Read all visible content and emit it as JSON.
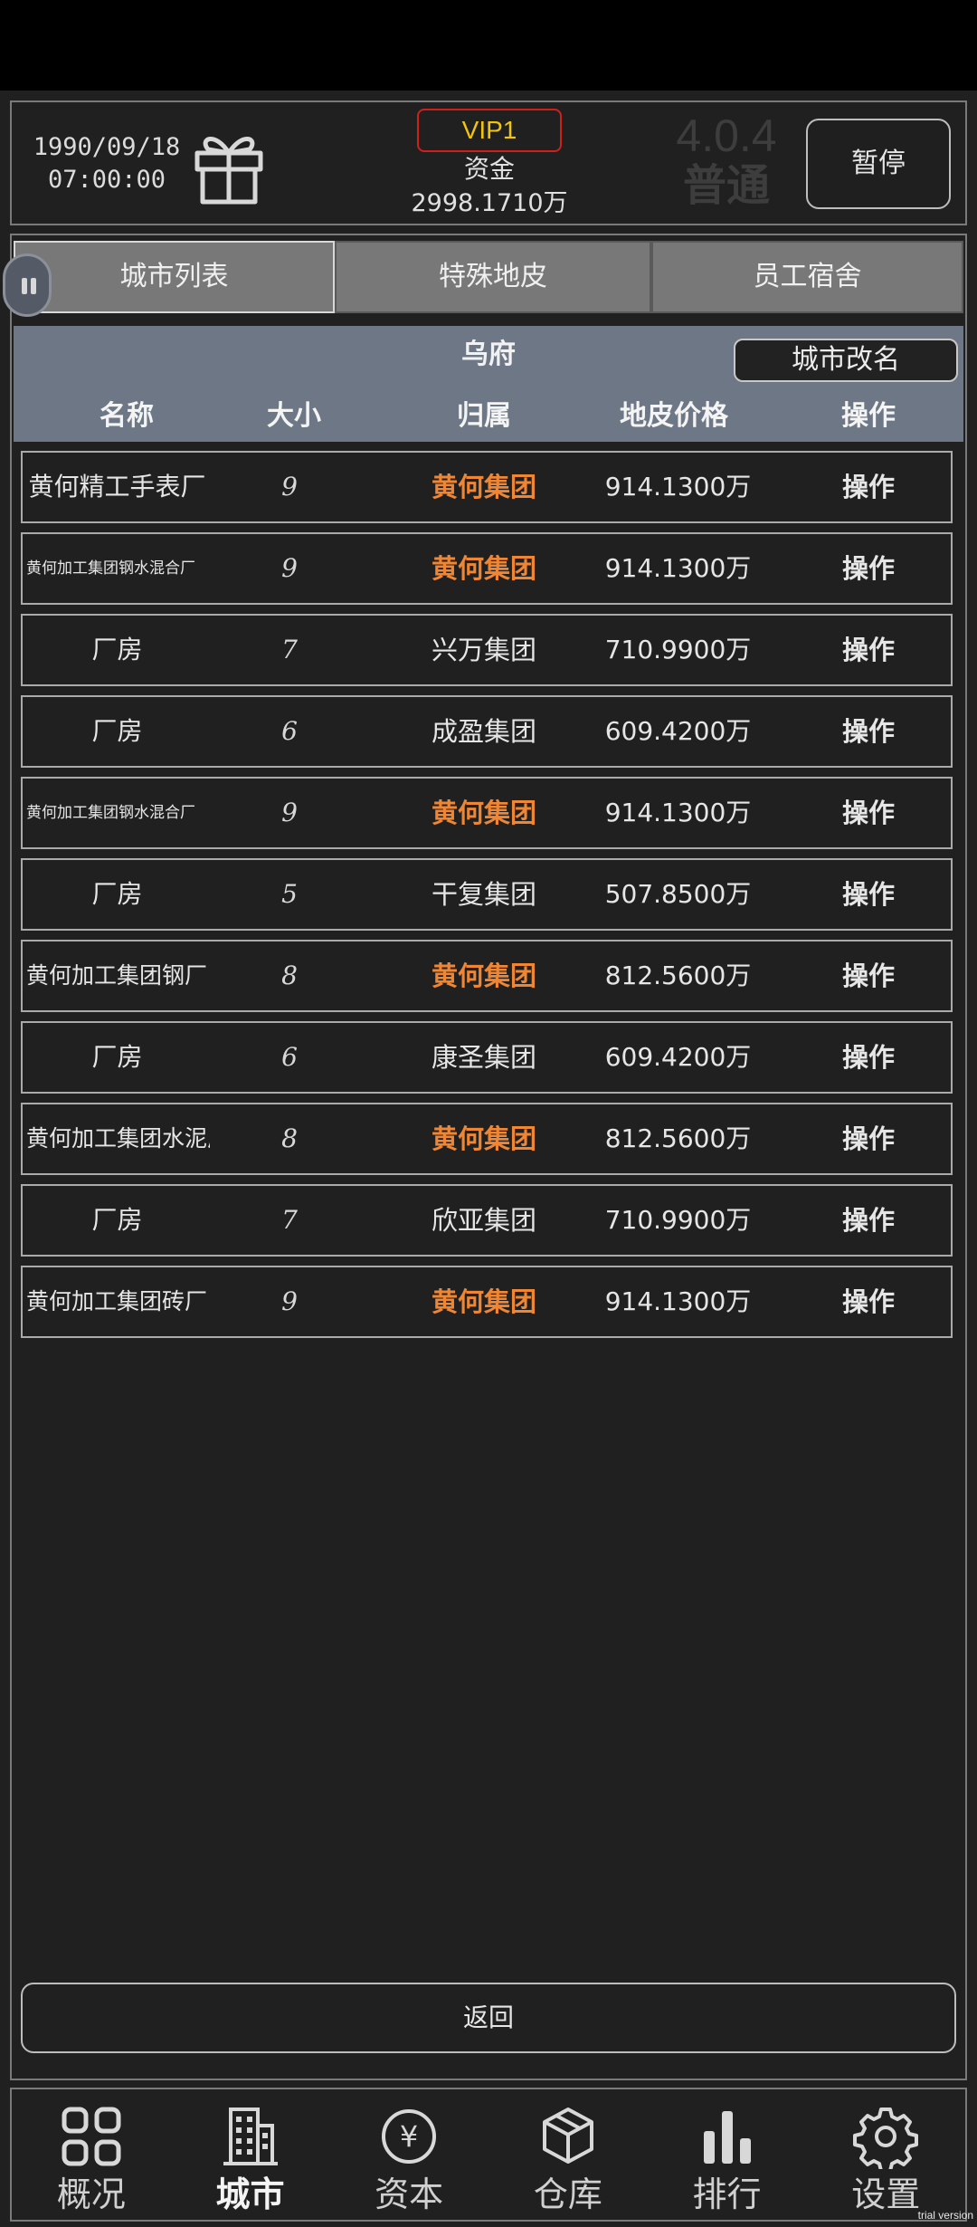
{
  "header": {
    "date": "1990/09/18",
    "time": "07:00:00",
    "vip": "VIP1",
    "funds_label": "资金",
    "funds_value": "2998.1710万",
    "version": "4.0.4",
    "mode": "普通",
    "pause_label": "暂停"
  },
  "tabs": [
    {
      "label": "城市列表",
      "active": true
    },
    {
      "label": "特殊地皮",
      "active": false
    },
    {
      "label": "员工宿舍",
      "active": false
    }
  ],
  "city": {
    "name": "乌府",
    "rename_label": "城市改名",
    "columns": [
      "名称",
      "大小",
      "归属",
      "地皮价格",
      "操作"
    ]
  },
  "rows": [
    {
      "name": "黄何精工手表厂",
      "size": "9",
      "owner": "黄何集团",
      "price": "914.1300万",
      "op": "操作",
      "mine": true
    },
    {
      "name": "黄何加工集团钢水混合厂",
      "size": "9",
      "owner": "黄何集团",
      "price": "914.1300万",
      "op": "操作",
      "mine": true
    },
    {
      "name": "厂房",
      "size": "7",
      "owner": "兴万集团",
      "price": "710.9900万",
      "op": "操作",
      "mine": false
    },
    {
      "name": "厂房",
      "size": "6",
      "owner": "成盈集团",
      "price": "609.4200万",
      "op": "操作",
      "mine": false
    },
    {
      "name": "黄何加工集团钢水混合厂",
      "size": "9",
      "owner": "黄何集团",
      "price": "914.1300万",
      "op": "操作",
      "mine": true
    },
    {
      "name": "厂房",
      "size": "5",
      "owner": "干复集团",
      "price": "507.8500万",
      "op": "操作",
      "mine": false
    },
    {
      "name": "黄何加工集团钢厂",
      "size": "8",
      "owner": "黄何集团",
      "price": "812.5600万",
      "op": "操作",
      "mine": true
    },
    {
      "name": "厂房",
      "size": "6",
      "owner": "康圣集团",
      "price": "609.4200万",
      "op": "操作",
      "mine": false
    },
    {
      "name": "黄何加工集团水泥厂",
      "size": "8",
      "owner": "黄何集团",
      "price": "812.5600万",
      "op": "操作",
      "mine": true
    },
    {
      "name": "厂房",
      "size": "7",
      "owner": "欣亚集团",
      "price": "710.9900万",
      "op": "操作",
      "mine": false
    },
    {
      "name": "黄何加工集团砖厂",
      "size": "9",
      "owner": "黄何集团",
      "price": "914.1300万",
      "op": "操作",
      "mine": true
    }
  ],
  "back_label": "返回",
  "nav": [
    {
      "label": "概况",
      "icon": "grid-icon",
      "active": false
    },
    {
      "label": "城市",
      "icon": "building-icon",
      "active": true
    },
    {
      "label": "资本",
      "icon": "yen-coin-icon",
      "active": false
    },
    {
      "label": "仓库",
      "icon": "box-icon",
      "active": false
    },
    {
      "label": "排行",
      "icon": "bar-chart-icon",
      "active": false
    },
    {
      "label": "设置",
      "icon": "gear-icon",
      "active": false
    }
  ],
  "watermark": "trial version",
  "colors": {
    "own_group": "#ef8634",
    "vip_text": "#f1c40f",
    "vip_border": "#d0201c",
    "table_header": "#6d7786"
  }
}
